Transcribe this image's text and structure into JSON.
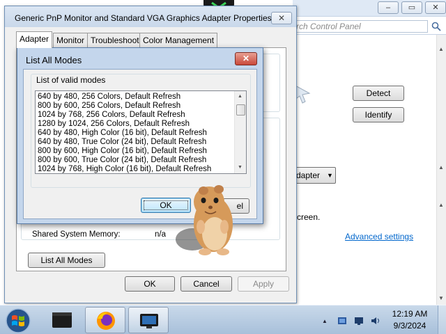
{
  "background_window": {
    "search_placeholder": "rch Control Panel",
    "detect_label": "Detect",
    "identify_label": "Identify",
    "adapter_dropdown": "dapter",
    "screen_text": "creen.",
    "advanced_settings_link": "Advanced settings"
  },
  "properties_dialog": {
    "title": "Generic PnP Monitor and Standard VGA Graphics Adapter Properties",
    "close_glyph": "✕",
    "tabs": [
      {
        "label": "Adapter"
      },
      {
        "label": "Monitor"
      },
      {
        "label": "Troubleshoot"
      },
      {
        "label": "Color Management"
      }
    ],
    "shared_memory_label": "Shared System Memory:",
    "shared_memory_value": "n/a",
    "list_all_modes_button": "List All Modes",
    "ok_button": "OK",
    "cancel_button": "Cancel",
    "apply_button": "Apply"
  },
  "modes_dialog": {
    "title": "List All Modes",
    "close_glyph": "✕",
    "group_label": "List of valid modes",
    "modes": [
      "640 by 480, 256 Colors, Default Refresh",
      "800 by 600, 256 Colors, Default Refresh",
      "1024 by 768, 256 Colors, Default Refresh",
      "1280 by 1024, 256 Colors, Default Refresh",
      "640 by 480, High Color (16 bit), Default Refresh",
      "640 by 480, True Color (24 bit), Default Refresh",
      "800 by 600, High Color (16 bit), Default Refresh",
      "800 by 600, True Color (24 bit), Default Refresh",
      "1024 by 768, High Color (16 bit), Default Refresh"
    ],
    "ok_button": "OK",
    "cancel_partial": "el"
  },
  "taskbar": {
    "time": "12:19 AM",
    "date": "9/3/2024"
  }
}
